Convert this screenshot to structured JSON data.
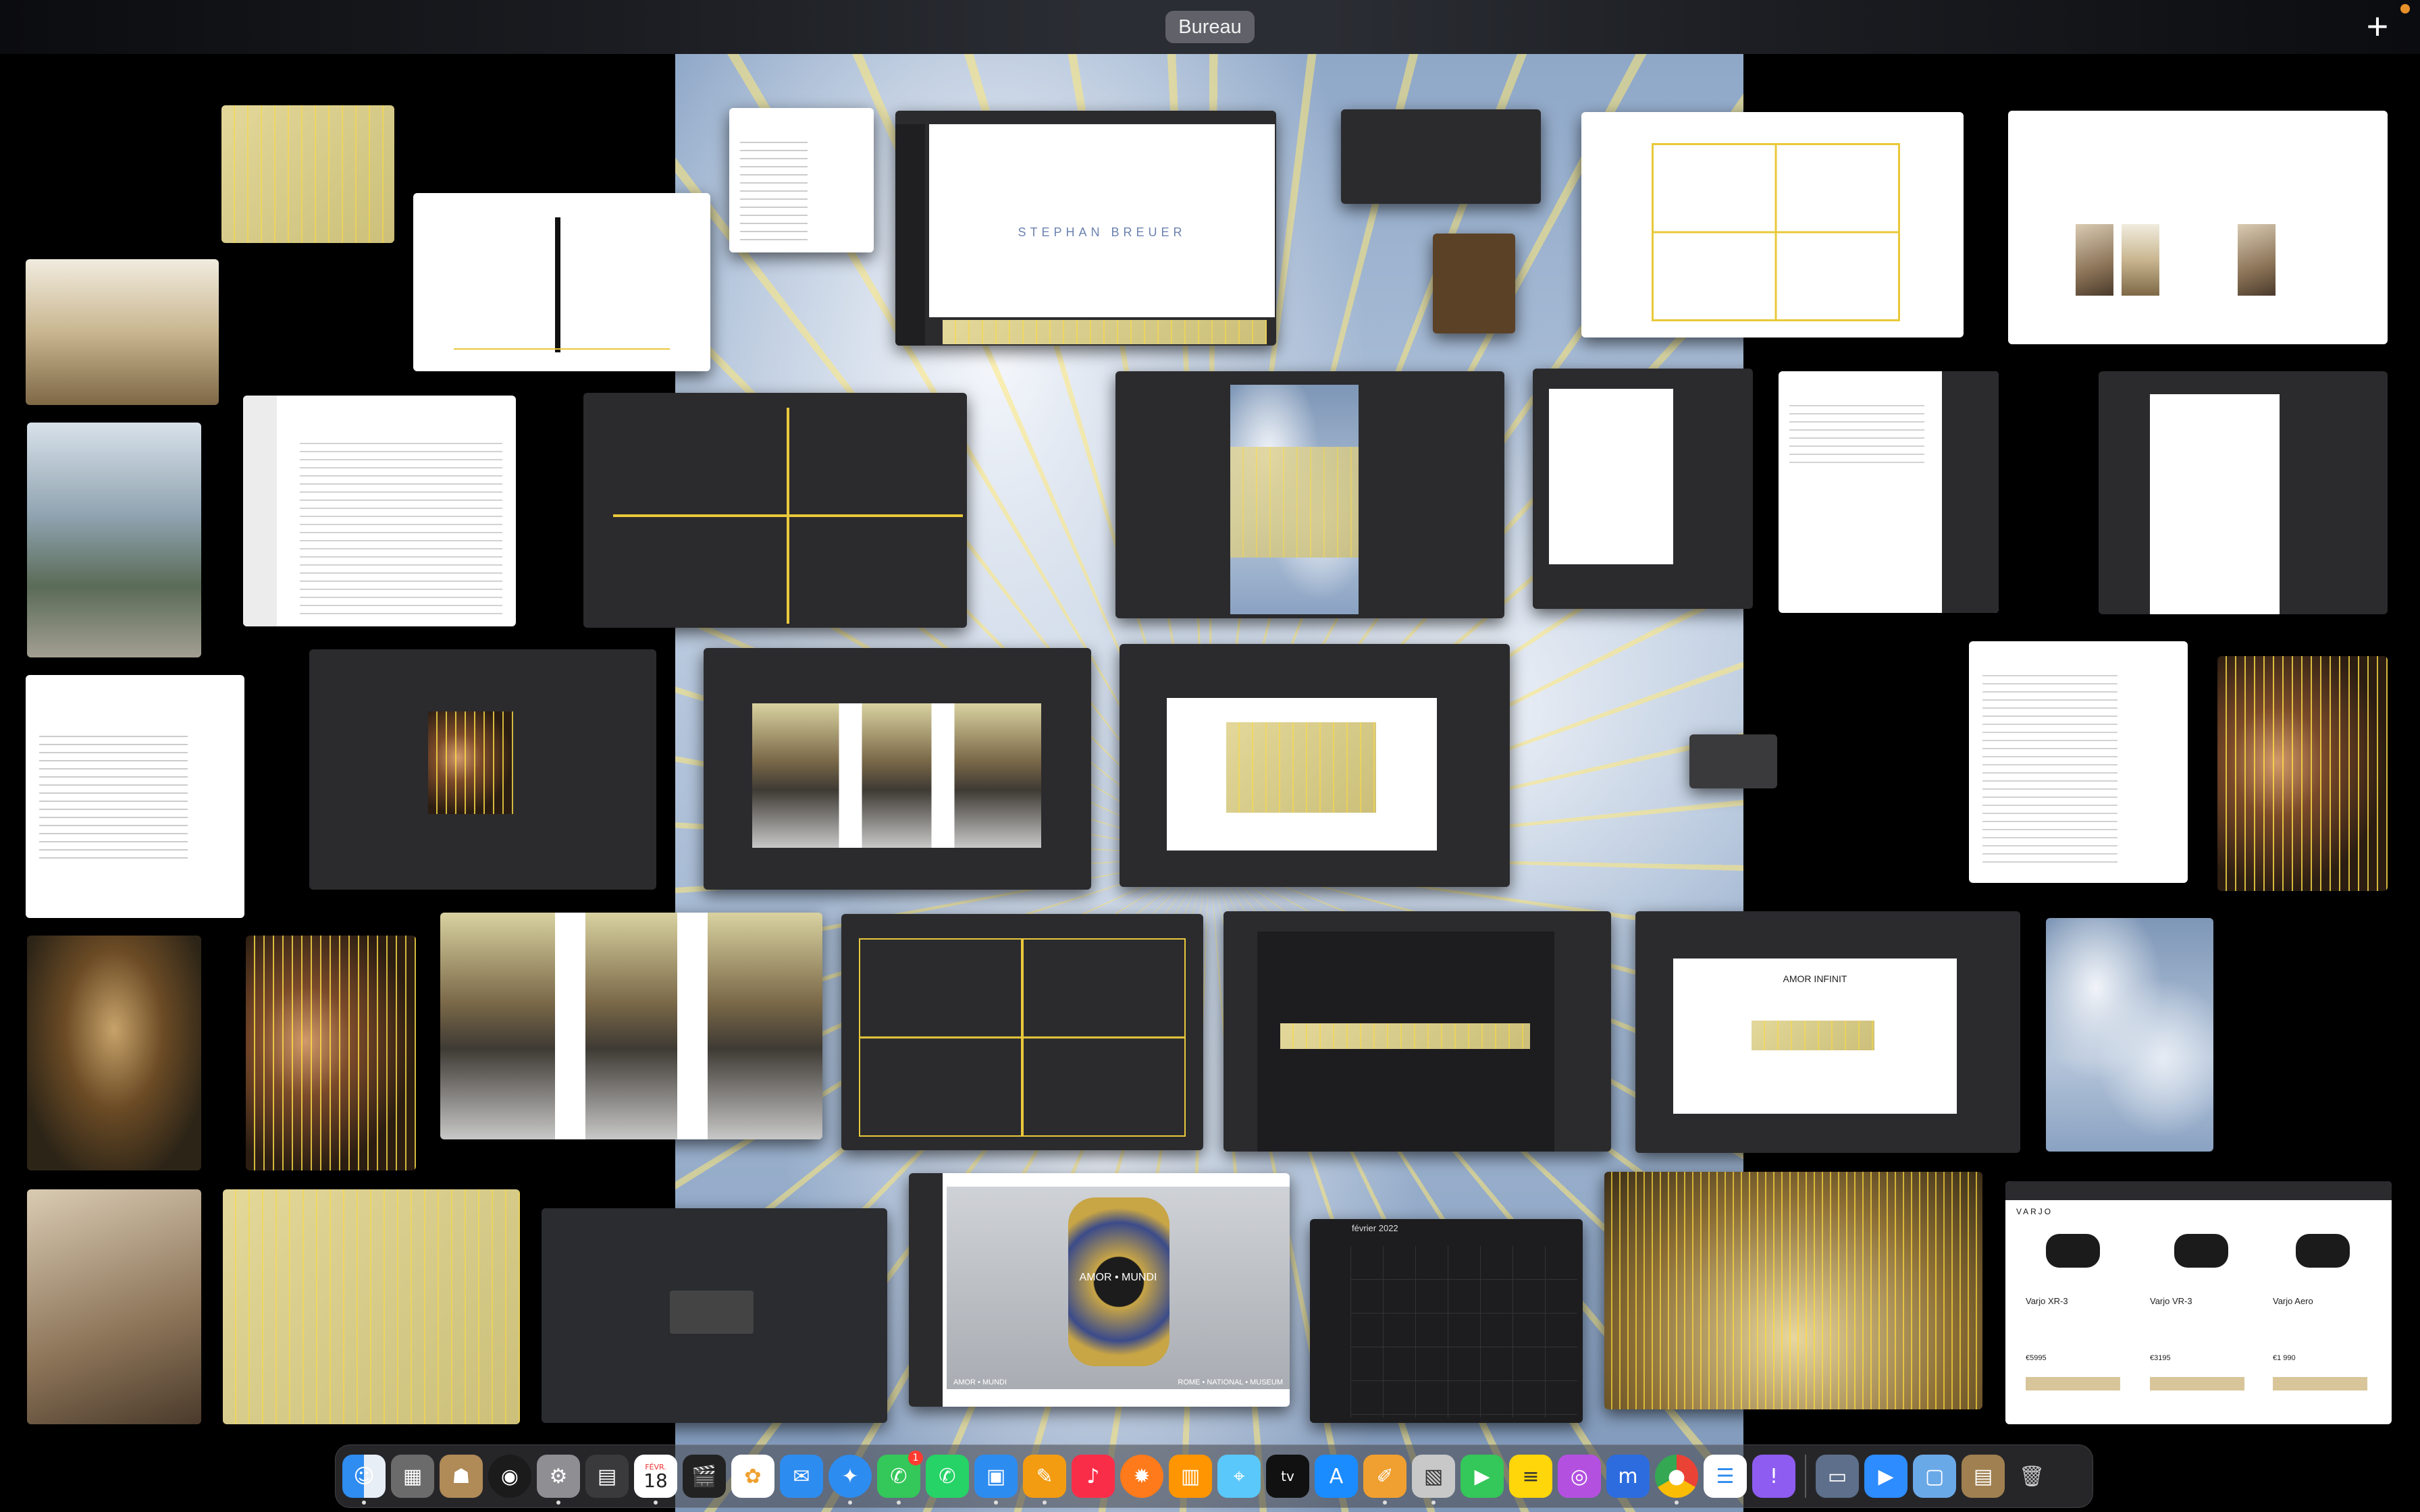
{
  "topbar": {
    "space_label": "Bureau",
    "add_space_symbol": "+"
  },
  "windows": {
    "keynote_title": "STEPHAN BREUER",
    "amor_caption": "AMOR • MUNDI",
    "amor_footer_left": "AMOR • MUNDI",
    "amor_footer_right": "ROME • NATIONAL • MUSEUM",
    "amor_infinit_title": "AMOR INFINIT",
    "calendar_month": "février 2022",
    "varjo_brand": "VARJO",
    "varjo_products": [
      "Varjo XR-3",
      "Varjo VR-3",
      "Varjo Aero"
    ],
    "varjo_prices": [
      "€5995",
      "€3195",
      "€1 990"
    ]
  },
  "dock": {
    "calendar_day": "18",
    "calendar_month": "FÉVR.",
    "messages_badge": "1",
    "items": [
      "finder-icon",
      "launchpad-icon",
      "contacts-icon",
      "spotlight-icon",
      "system-preferences-icon",
      "calculator-icon",
      "calendar-icon",
      "final-cut-icon",
      "photos-icon",
      "mail-icon",
      "safari-icon",
      "messages-icon",
      "whatsapp-icon",
      "keynote-icon",
      "pages-icon",
      "music-icon",
      "firefox-icon",
      "books-icon",
      "maps-icon",
      "tv-icon",
      "app-store-icon",
      "pixelmator-icon",
      "preview-icon",
      "facetime-icon",
      "notes-icon",
      "podcasts-icon",
      "dictionary-icon",
      "chrome-icon",
      "reminders-icon",
      "feedback-icon",
      "downloads-stack-icon",
      "zoom-icon",
      "folder-icon",
      "document-stack-icon",
      "trash-icon"
    ]
  },
  "colors": {
    "accent_gold": "#e9c83a",
    "pill_bg": "#8c8c96",
    "notification": "#e8902a"
  }
}
